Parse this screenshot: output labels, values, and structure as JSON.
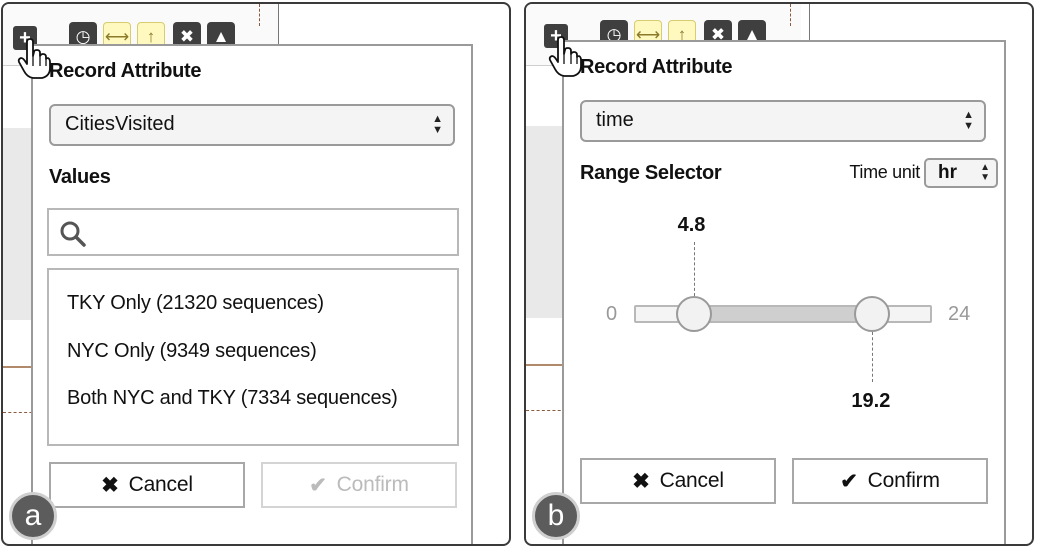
{
  "panel_a": {
    "badge": "a",
    "popover": {
      "title": "Record Attribute",
      "attribute_value": "CitiesVisited",
      "values_label": "Values",
      "search_placeholder": "",
      "items": [
        {
          "label": "TKY Only (21320 sequences)"
        },
        {
          "label": "NYC Only (9349 sequences)"
        },
        {
          "label": "Both NYC and TKY (7334 sequences)"
        }
      ],
      "cancel_label": "Cancel",
      "confirm_label": "Confirm",
      "confirm_enabled": false
    }
  },
  "panel_b": {
    "badge": "b",
    "popover": {
      "title": "Record Attribute",
      "attribute_value": "time",
      "range_label": "Range Selector",
      "time_unit_label": "Time unit",
      "time_unit_value": "hr",
      "range": {
        "min": 0,
        "max": 24,
        "low": 4.8,
        "high": 19.2
      },
      "range_min_text": "0",
      "range_max_text": "24",
      "low_text": "4.8",
      "high_text": "19.2",
      "cancel_label": "Cancel",
      "confirm_label": "Confirm",
      "confirm_enabled": true
    }
  },
  "toolbar_icons": [
    "plus-icon",
    "clock-icon",
    "horizontal-arrows-icon",
    "up-arrow-icon",
    "close-icon",
    "chevron-up-icon"
  ],
  "cursor": "pointing-hand-cursor-icon",
  "colors": {
    "toolbar_dark": "#3f3f3f",
    "toolbar_highlight": "#fff8bf",
    "slider_fill": "#cfcfcf",
    "border_gray": "#9a9a9a"
  }
}
